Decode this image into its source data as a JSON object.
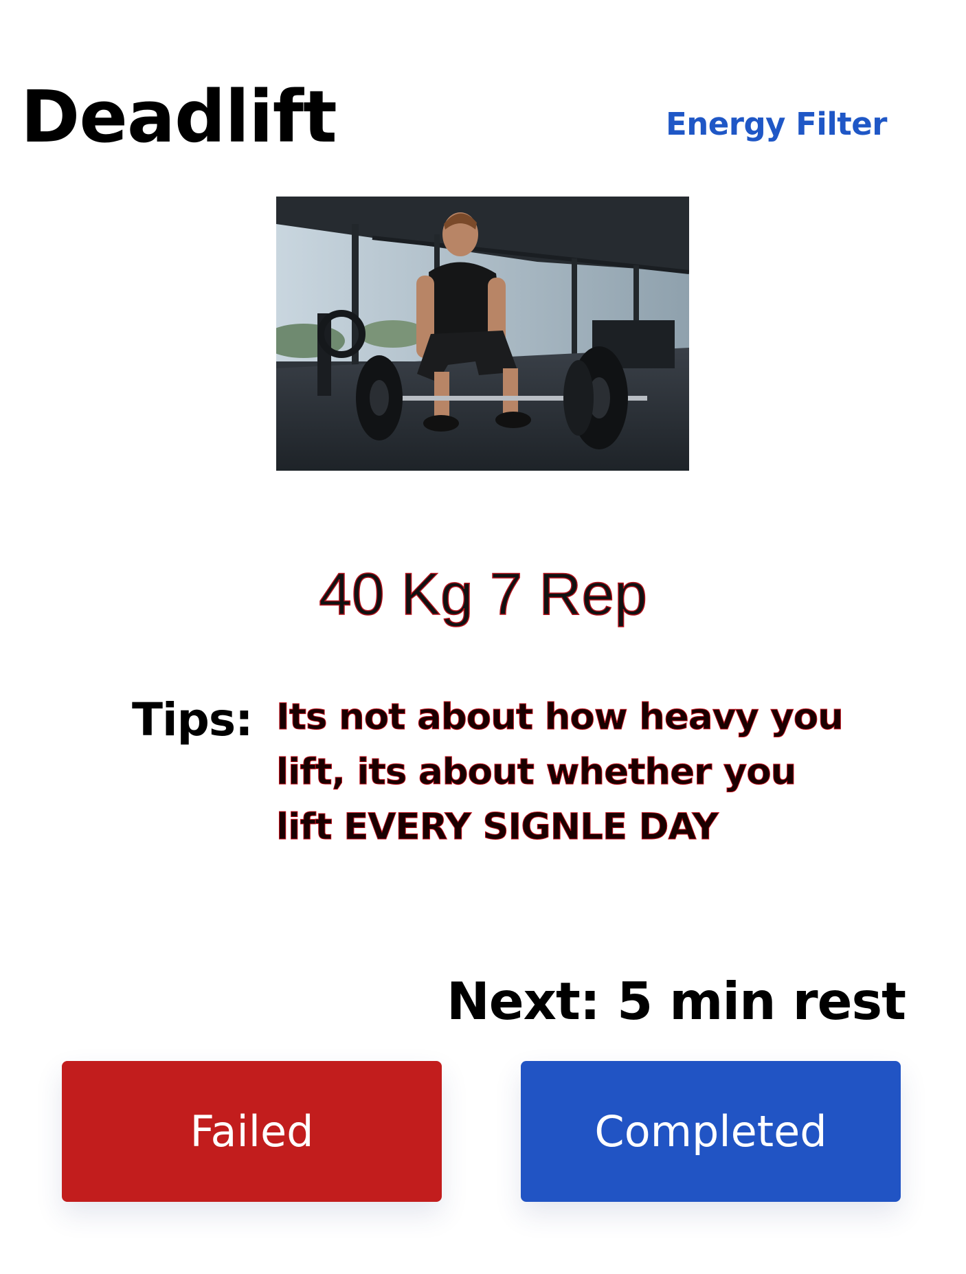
{
  "header": {
    "title": "Deadlift",
    "energy_filter_label": "Energy Filter"
  },
  "exercise": {
    "image_alt": "Man performing a deadlift with a barbell in a gym",
    "weight_reps": "40 Kg 7 Rep",
    "tips_label": "Tips:",
    "tips_lines": [
      "Its not about how heavy you",
      "lift, its about whether you",
      "lift EVERY SIGNLE DAY"
    ],
    "next": "Next: 5 min rest"
  },
  "actions": {
    "failed_label": "Failed",
    "completed_label": "Completed"
  },
  "colors": {
    "link": "#1f57c6",
    "failed": "#c21d1d",
    "completed": "#2154c4",
    "tips_outline": "#c4101c"
  }
}
